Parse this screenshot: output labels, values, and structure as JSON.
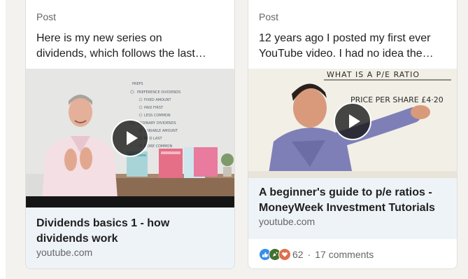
{
  "colors": {
    "page_bg": "#f4f2ee",
    "card_bg": "#ffffff",
    "link_box_bg": "#eef3f8",
    "like_blue": "#378fe9",
    "celebrate_green": "#44712e",
    "love_red": "#df704d"
  },
  "cards": [
    {
      "kind": "Post",
      "text": "Here is my new series on\ndividends, which follows the last…",
      "video": {
        "whiteboard_lines": [
          "PREFERENCE DIVIDENDS",
          "FIXED AMOUNT",
          "PAID FIRST",
          "LESS COMMON",
          "ORDINARY DIVIDENDS",
          "VARIABLE AMOUNT",
          "PAID LAST",
          "MORE COMMON"
        ],
        "play_icon": "play-icon"
      },
      "link": {
        "title": "Dividends basics 1 - how\ndividends work",
        "domain": "youtube.com"
      }
    },
    {
      "kind": "Post",
      "text": "12 years ago I posted my first ever\nYouTube video. I had no idea the…",
      "video": {
        "whiteboard_lines": [
          "WHAT IS A P/E RATIO",
          "PRICE PER SHARE £4·20"
        ],
        "play_icon": "play-icon"
      },
      "link": {
        "title": "A beginner's guide to p/e ratios -\nMoneyWeek Investment Tutorials",
        "domain": "youtube.com"
      },
      "social": {
        "reaction_icons": [
          "like-icon",
          "celebrate-icon",
          "love-icon"
        ],
        "reaction_count": "62",
        "separator": "·",
        "comments": "17 comments"
      }
    }
  ]
}
